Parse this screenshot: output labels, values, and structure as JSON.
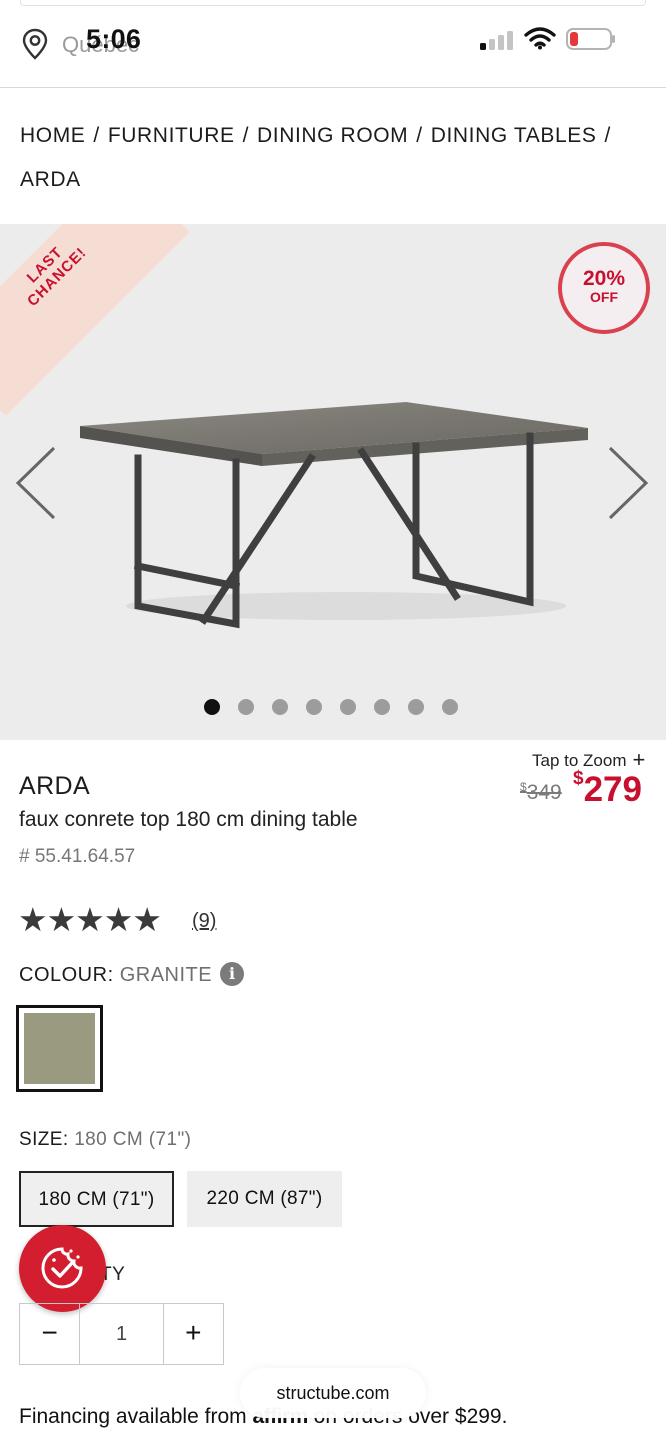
{
  "status_bar": {
    "time": "5:06",
    "location": "Québec",
    "icons": [
      "location-pin-icon",
      "cellular-signal-icon",
      "wifi-icon",
      "battery-low-icon"
    ]
  },
  "breadcrumb": {
    "items": [
      "HOME",
      "FURNITURE",
      "DINING ROOM",
      "DINING TABLES",
      "ARDA"
    ],
    "separator": "/"
  },
  "gallery": {
    "ribbon": "LAST CHANCE!",
    "discount_pct": "20%",
    "discount_off": "OFF",
    "total_images": 8,
    "active_index": 0,
    "icons": [
      "chevron-left-icon",
      "chevron-right-icon"
    ]
  },
  "product": {
    "name": "ARDA",
    "description": "faux conrete top 180 cm dining table",
    "sku": "# 55.41.64.57",
    "tap_to_zoom": "Tap to Zoom",
    "zoom_plus": "+",
    "price_old_symbol": "$",
    "price_old": "349",
    "price_new_symbol": "$",
    "price_new": "279",
    "rating": 5,
    "stars": "★★★★★",
    "review_count": "(9)"
  },
  "colour": {
    "label": "COLOUR:",
    "value": "GRANITE",
    "info": "i",
    "swatch_color": "#9a9a80"
  },
  "size": {
    "label": "SIZE:",
    "value": "180 CM (71\")",
    "options": [
      "180 CM (71\")",
      "220 CM (87\")"
    ],
    "selected": 0
  },
  "quantity": {
    "label_visible": "TY",
    "minus": "−",
    "value": "1",
    "plus": "+"
  },
  "financing": {
    "before": "Financing available from ",
    "brand": "affirm",
    "after": " on orders over $299."
  },
  "browser": {
    "url": "structube.com"
  },
  "colors": {
    "accent_red": "#c8102e",
    "badge_red": "#d21e2f"
  }
}
